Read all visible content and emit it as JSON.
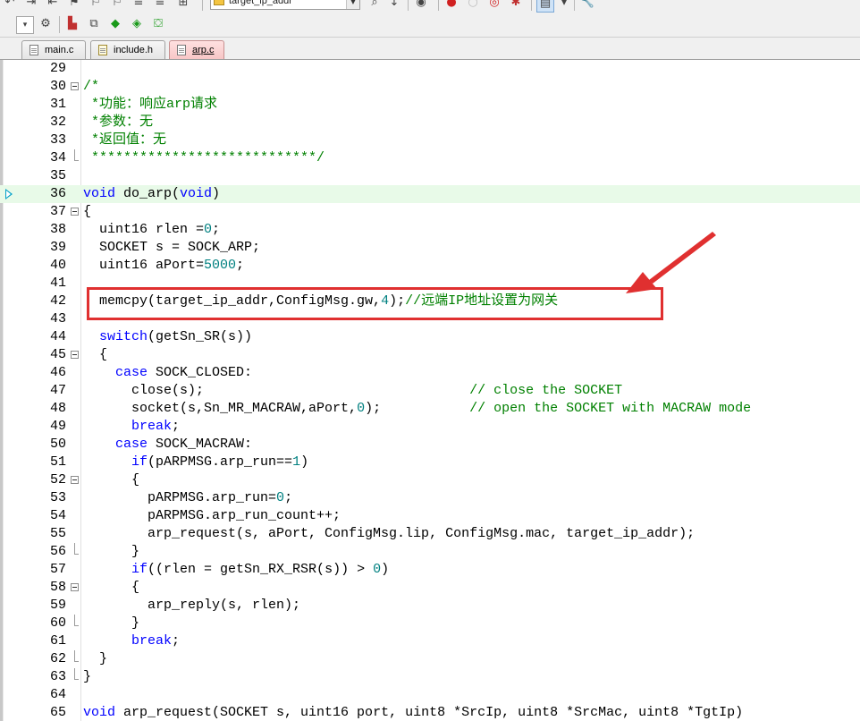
{
  "toolbar": {
    "target_combo_value": "target_ip_addr"
  },
  "tabs": [
    {
      "label": "main.c",
      "active": false
    },
    {
      "label": "include.h",
      "active": false
    },
    {
      "label": "arp.c",
      "active": true
    }
  ],
  "editor": {
    "current_line": 36,
    "highlighted_line": 42,
    "lines": [
      {
        "num": "29",
        "text": ""
      },
      {
        "num": "30",
        "text": "/*"
      },
      {
        "num": "31",
        "text": " *功能：响应arp请求"
      },
      {
        "num": "32",
        "text": " *参数：无"
      },
      {
        "num": "33",
        "text": " *返回值：无"
      },
      {
        "num": "34",
        "text": " ****************************/"
      },
      {
        "num": "35",
        "text": ""
      },
      {
        "num": "36",
        "text": "void do_arp(void)"
      },
      {
        "num": "37",
        "text": "{"
      },
      {
        "num": "38",
        "text": "  uint16 rlen =0;"
      },
      {
        "num": "39",
        "text": "  SOCKET s = SOCK_ARP;"
      },
      {
        "num": "40",
        "text": "  uint16 aPort=5000;"
      },
      {
        "num": "41",
        "text": ""
      },
      {
        "num": "42",
        "text": "  memcpy(target_ip_addr,ConfigMsg.gw,4);//远端IP地址设置为网关"
      },
      {
        "num": "43",
        "text": ""
      },
      {
        "num": "44",
        "text": "  switch(getSn_SR(s))"
      },
      {
        "num": "45",
        "text": "  {"
      },
      {
        "num": "46",
        "text": "    case SOCK_CLOSED:"
      },
      {
        "num": "47",
        "text": "      close(s);                                 // close the SOCKET"
      },
      {
        "num": "48",
        "text": "      socket(s,Sn_MR_MACRAW,aPort,0);           // open the SOCKET with MACRAW mode"
      },
      {
        "num": "49",
        "text": "      break;"
      },
      {
        "num": "50",
        "text": "    case SOCK_MACRAW:"
      },
      {
        "num": "51",
        "text": "      if(pARPMSG.arp_run==1)"
      },
      {
        "num": "52",
        "text": "      {"
      },
      {
        "num": "53",
        "text": "        pARPMSG.arp_run=0;"
      },
      {
        "num": "54",
        "text": "        pARPMSG.arp_run_count++;"
      },
      {
        "num": "55",
        "text": "        arp_request(s, aPort, ConfigMsg.lip, ConfigMsg.mac, target_ip_addr);"
      },
      {
        "num": "56",
        "text": "      }"
      },
      {
        "num": "57",
        "text": "      if((rlen = getSn_RX_RSR(s)) > 0)"
      },
      {
        "num": "58",
        "text": "      {"
      },
      {
        "num": "59",
        "text": "        arp_reply(s, rlen);"
      },
      {
        "num": "60",
        "text": "      }"
      },
      {
        "num": "61",
        "text": "      break;"
      },
      {
        "num": "62",
        "text": "  }"
      },
      {
        "num": "63",
        "text": "}"
      },
      {
        "num": "64",
        "text": ""
      },
      {
        "num": "65",
        "text": "void arp_request(SOCKET s, uint16 port, uint8 *SrcIp, uint8 *SrcMac, uint8 *TgtIp)"
      }
    ]
  },
  "colors": {
    "comment": "#008000",
    "keyword": "#0000ff",
    "number": "#008080",
    "current_line_bg": "#e8fae8",
    "annotation": "#e03030",
    "active_tab": "#f6c4c4"
  }
}
